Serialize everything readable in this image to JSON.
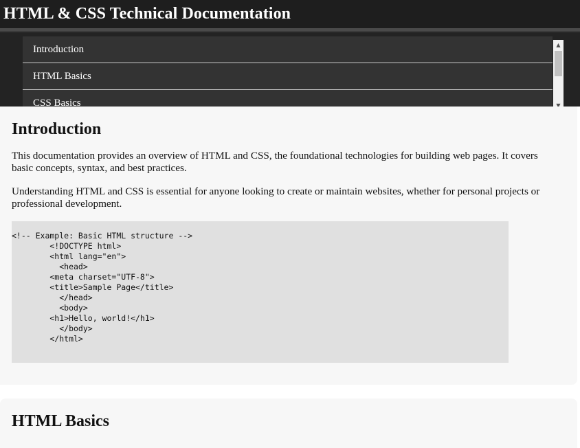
{
  "header": {
    "title": "HTML & CSS Technical Documentation"
  },
  "nav": {
    "items": [
      {
        "label": "Introduction"
      },
      {
        "label": "HTML Basics"
      },
      {
        "label": "CSS Basics"
      }
    ]
  },
  "sections": [
    {
      "title": "Introduction",
      "paragraphs": [
        "This documentation provides an overview of HTML and CSS, the foundational technologies for building web pages. It covers basic concepts, syntax, and best practices.",
        "Understanding HTML and CSS is essential for anyone looking to create or maintain websites, whether for personal projects or professional development."
      ],
      "code": "<!-- Example: Basic HTML structure -->\n        <!DOCTYPE html>\n        <html lang=\"en\">\n          <head>\n        <meta charset=\"UTF-8\">\n        <title>Sample Page</title>\n          </head>\n          <body>\n        <h1>Hello, world!</h1>\n          </body>\n        </html>"
    },
    {
      "title": "HTML Basics"
    }
  ],
  "icons": {
    "scroll_up": "scroll-up-arrow-icon",
    "scroll_down": "scroll-down-arrow-icon"
  },
  "colors": {
    "header_bg": "#1e1e1e",
    "nav_item_bg": "#333333",
    "section_bg": "#f7f7f7",
    "code_bg": "#e0e0e0"
  }
}
